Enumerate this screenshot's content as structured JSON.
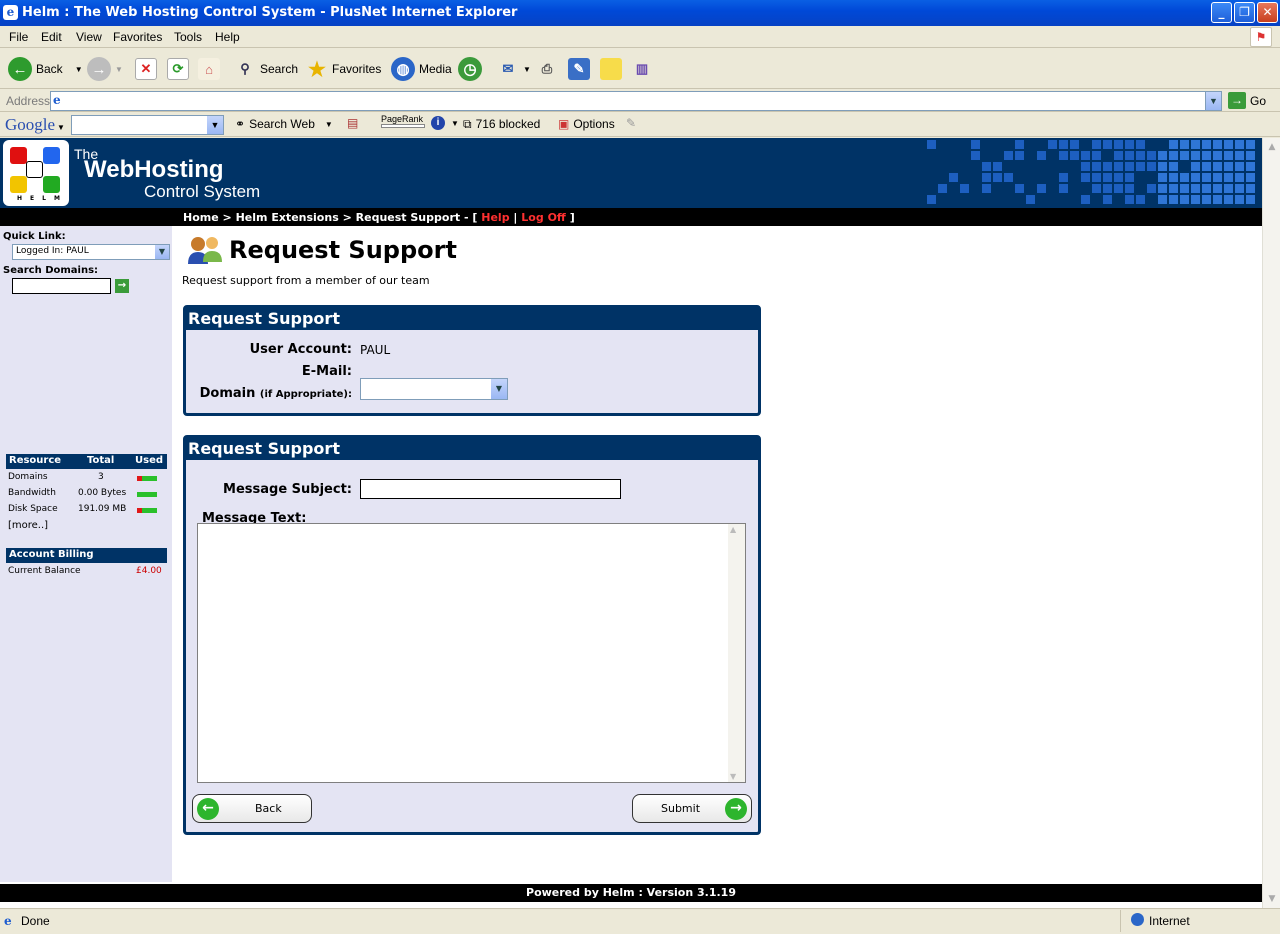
{
  "window": {
    "title": "Helm : The Web Hosting Control System - PlusNet Internet Explorer"
  },
  "menu": [
    "File",
    "Edit",
    "View",
    "Favorites",
    "Tools",
    "Help"
  ],
  "toolbar": {
    "back": "Back",
    "search": "Search",
    "favorites": "Favorites",
    "media": "Media"
  },
  "address": {
    "label": "Address",
    "value": "",
    "go": "Go"
  },
  "googlebar": {
    "logo": "Google",
    "search_web": "Search Web",
    "pagerank": "PageRank",
    "blocked": "716 blocked",
    "options": "Options"
  },
  "brand": {
    "line1": "The",
    "line2": "WebHosting",
    "line3": "Control System",
    "logo_text": "HELM"
  },
  "nav": {
    "home": "Home",
    "sep": ">",
    "extensions": "Helm Extensions",
    "current": "Request Support",
    "dash": "- [",
    "help": "Help",
    "pipe": "|",
    "logoff": "Log Off",
    "close": "]"
  },
  "sidebar": {
    "quick_link_label": "Quick Link:",
    "quick_link_value": "Logged In: PAUL",
    "search_label": "Search Domains:",
    "resources_header": {
      "resource": "Resource",
      "total": "Total",
      "used": "Used"
    },
    "resources": [
      {
        "name": "Domains",
        "total": "3",
        "used_fraction": 0.25
      },
      {
        "name": "Bandwidth",
        "total": "0.00 Bytes",
        "used_fraction": 0.0
      },
      {
        "name": "Disk Space",
        "total": "191.09 MB",
        "used_fraction": 0.25
      }
    ],
    "more": "[more..]",
    "billing_header": "Account Billing",
    "billing": {
      "label": "Current Balance",
      "value": "£4.00"
    }
  },
  "page": {
    "title": "Request Support",
    "subtitle": "Request support from a member of our team"
  },
  "panel1": {
    "title": "Request Support",
    "user_account_label": "User Account:",
    "user_account_value": "PAUL",
    "email_label": "E-Mail:",
    "email_value": "",
    "domain_label": "Domain",
    "domain_hint": "(if Appropriate):",
    "domain_value": ""
  },
  "panel2": {
    "title": "Request Support",
    "subject_label": "Message Subject:",
    "subject_value": "",
    "text_label": "Message Text:",
    "text_value": "",
    "back_button": "Back",
    "submit_button": "Submit"
  },
  "footer": "Powered by Helm  :  Version 3.1.19",
  "status": {
    "left": "Done",
    "zone": "Internet"
  },
  "colors": {
    "helm_navy": "#003366",
    "panel_bg": "#e4e4f3",
    "nav_red": "#ff3030",
    "balance_red": "#cc0000",
    "xp_blue": "#0049d8"
  }
}
